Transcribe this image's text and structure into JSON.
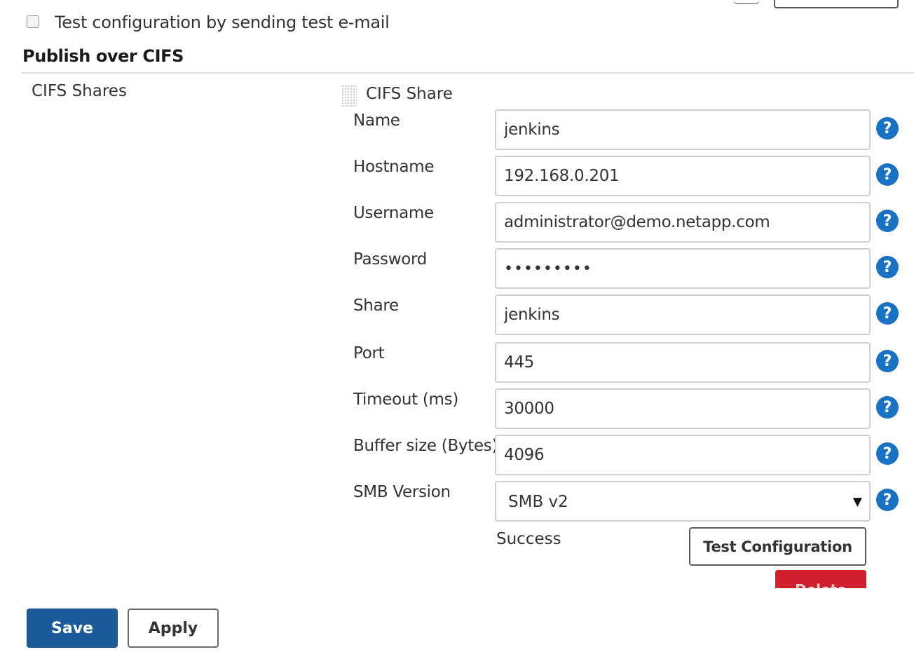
{
  "test_email": {
    "label": "Test configuration by sending test e-mail",
    "checked": false
  },
  "section": {
    "title": "Publish over CIFS"
  },
  "cifs_shares": {
    "label": "CIFS Shares",
    "share_title": "CIFS Share",
    "fields": [
      {
        "label": "Name",
        "value": "jenkins"
      },
      {
        "label": "Hostname",
        "value": "192.168.0.201"
      },
      {
        "label": "Username",
        "value": "administrator@demo.netapp.com"
      },
      {
        "label": "Password",
        "value": "•••••••••"
      },
      {
        "label": "Share",
        "value": "jenkins"
      },
      {
        "label": "Port",
        "value": "445"
      },
      {
        "label": "Timeout (ms)",
        "value": "30000"
      },
      {
        "label": "Buffer size (Bytes)",
        "value": "4096"
      }
    ],
    "smb_version": {
      "label": "SMB Version",
      "selected": "SMB v2"
    },
    "help_glyph": "?",
    "status": "Success",
    "test_button": "Test Configuration",
    "delete_button": "Delete"
  },
  "footer": {
    "save_label": "Save",
    "apply_label": "Apply"
  },
  "colors": {
    "help_icon": "#1a72c4",
    "save_button": "#1b5b99",
    "delete_button": "#d0202e"
  }
}
